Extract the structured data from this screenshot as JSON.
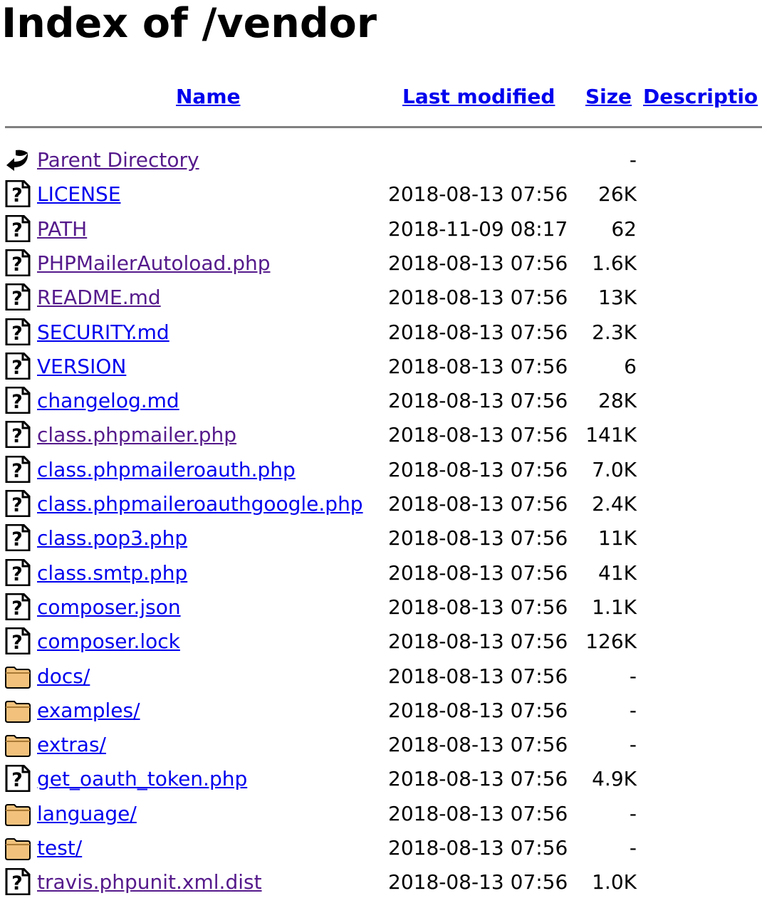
{
  "page": {
    "title": "Index of /vendor"
  },
  "columns": {
    "name": "Name",
    "last_modified": "Last modified",
    "size": "Size",
    "description": "Descriptio"
  },
  "colors": {
    "link": "#0000ee",
    "visited": "#551a8b",
    "rule": "#808080",
    "folder": "#f2c27c"
  },
  "rows": [
    {
      "icon": "back-arrow-icon",
      "name": "Parent Directory",
      "date": "",
      "size": "-",
      "visited": true
    },
    {
      "icon": "unknown-file-icon",
      "name": "LICENSE",
      "date": "2018-08-13 07:56",
      "size": "26K",
      "visited": false
    },
    {
      "icon": "unknown-file-icon",
      "name": "PATH",
      "date": "2018-11-09 08:17",
      "size": "62",
      "visited": true
    },
    {
      "icon": "unknown-file-icon",
      "name": "PHPMailerAutoload.php",
      "date": "2018-08-13 07:56",
      "size": "1.6K",
      "visited": true
    },
    {
      "icon": "unknown-file-icon",
      "name": "README.md",
      "date": "2018-08-13 07:56",
      "size": "13K",
      "visited": true
    },
    {
      "icon": "unknown-file-icon",
      "name": "SECURITY.md",
      "date": "2018-08-13 07:56",
      "size": "2.3K",
      "visited": false
    },
    {
      "icon": "unknown-file-icon",
      "name": "VERSION",
      "date": "2018-08-13 07:56",
      "size": "6",
      "visited": false
    },
    {
      "icon": "unknown-file-icon",
      "name": "changelog.md",
      "date": "2018-08-13 07:56",
      "size": "28K",
      "visited": false
    },
    {
      "icon": "unknown-file-icon",
      "name": "class.phpmailer.php",
      "date": "2018-08-13 07:56",
      "size": "141K",
      "visited": true
    },
    {
      "icon": "unknown-file-icon",
      "name": "class.phpmaileroauth.php",
      "date": "2018-08-13 07:56",
      "size": "7.0K",
      "visited": false
    },
    {
      "icon": "unknown-file-icon",
      "name": "class.phpmaileroauthgoogle.php",
      "date": "2018-08-13 07:56",
      "size": "2.4K",
      "visited": false
    },
    {
      "icon": "unknown-file-icon",
      "name": "class.pop3.php",
      "date": "2018-08-13 07:56",
      "size": "11K",
      "visited": false
    },
    {
      "icon": "unknown-file-icon",
      "name": "class.smtp.php",
      "date": "2018-08-13 07:56",
      "size": "41K",
      "visited": false
    },
    {
      "icon": "unknown-file-icon",
      "name": "composer.json",
      "date": "2018-08-13 07:56",
      "size": "1.1K",
      "visited": false
    },
    {
      "icon": "unknown-file-icon",
      "name": "composer.lock",
      "date": "2018-08-13 07:56",
      "size": "126K",
      "visited": false
    },
    {
      "icon": "folder-icon",
      "name": "docs/",
      "date": "2018-08-13 07:56",
      "size": "-",
      "visited": false
    },
    {
      "icon": "folder-icon",
      "name": "examples/",
      "date": "2018-08-13 07:56",
      "size": "-",
      "visited": false
    },
    {
      "icon": "folder-icon",
      "name": "extras/",
      "date": "2018-08-13 07:56",
      "size": "-",
      "visited": false
    },
    {
      "icon": "unknown-file-icon",
      "name": "get_oauth_token.php",
      "date": "2018-08-13 07:56",
      "size": "4.9K",
      "visited": false
    },
    {
      "icon": "folder-icon",
      "name": "language/",
      "date": "2018-08-13 07:56",
      "size": "-",
      "visited": false
    },
    {
      "icon": "folder-icon",
      "name": "test/",
      "date": "2018-08-13 07:56",
      "size": "-",
      "visited": false
    },
    {
      "icon": "unknown-file-icon",
      "name": "travis.phpunit.xml.dist",
      "date": "2018-08-13 07:56",
      "size": "1.0K",
      "visited": true
    }
  ]
}
